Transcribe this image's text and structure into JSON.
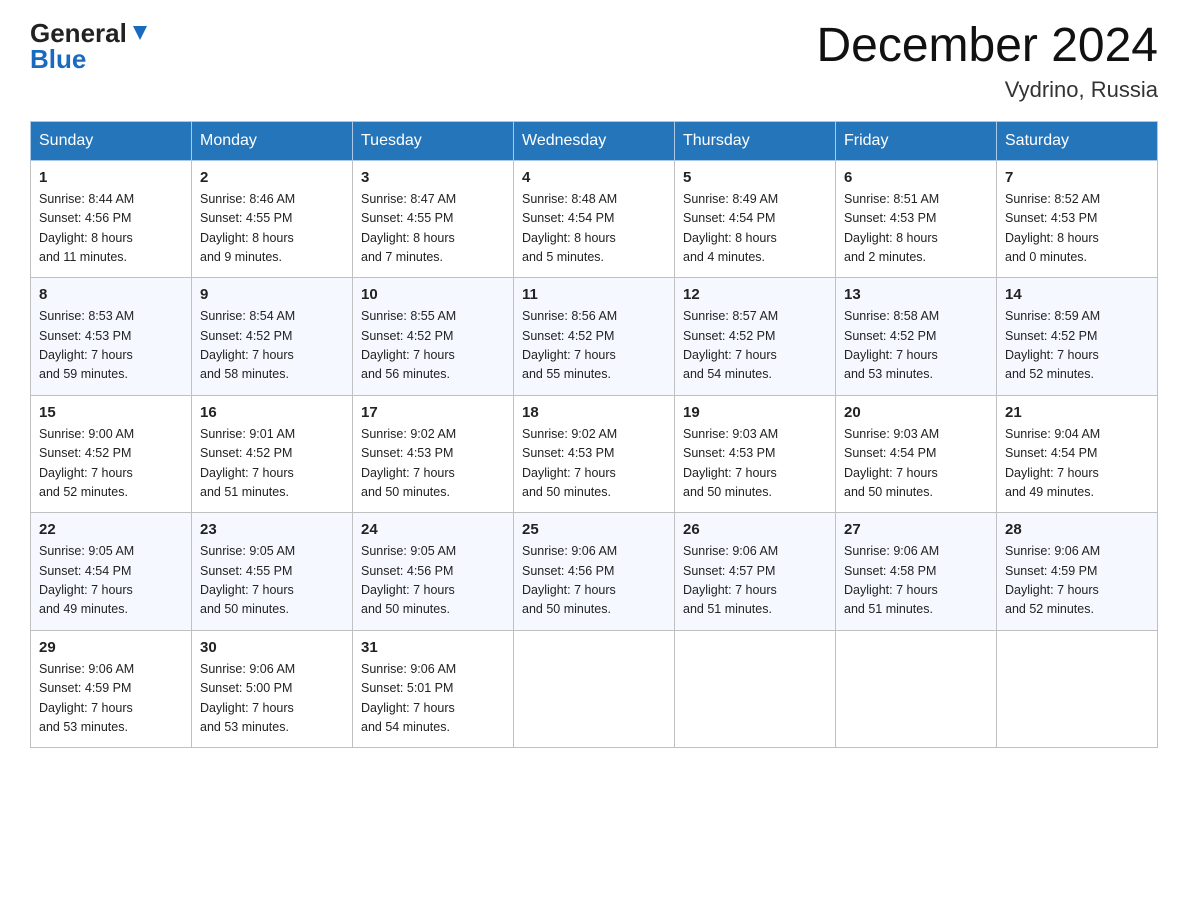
{
  "header": {
    "title": "December 2024",
    "location": "Vydrino, Russia",
    "logo_general": "General",
    "logo_blue": "Blue"
  },
  "days_of_week": [
    "Sunday",
    "Monday",
    "Tuesday",
    "Wednesday",
    "Thursday",
    "Friday",
    "Saturday"
  ],
  "weeks": [
    [
      {
        "day": "1",
        "sunrise": "8:44 AM",
        "sunset": "4:56 PM",
        "daylight": "8 hours and 11 minutes."
      },
      {
        "day": "2",
        "sunrise": "8:46 AM",
        "sunset": "4:55 PM",
        "daylight": "8 hours and 9 minutes."
      },
      {
        "day": "3",
        "sunrise": "8:47 AM",
        "sunset": "4:55 PM",
        "daylight": "8 hours and 7 minutes."
      },
      {
        "day": "4",
        "sunrise": "8:48 AM",
        "sunset": "4:54 PM",
        "daylight": "8 hours and 5 minutes."
      },
      {
        "day": "5",
        "sunrise": "8:49 AM",
        "sunset": "4:54 PM",
        "daylight": "8 hours and 4 minutes."
      },
      {
        "day": "6",
        "sunrise": "8:51 AM",
        "sunset": "4:53 PM",
        "daylight": "8 hours and 2 minutes."
      },
      {
        "day": "7",
        "sunrise": "8:52 AM",
        "sunset": "4:53 PM",
        "daylight": "8 hours and 0 minutes."
      }
    ],
    [
      {
        "day": "8",
        "sunrise": "8:53 AM",
        "sunset": "4:53 PM",
        "daylight": "7 hours and 59 minutes."
      },
      {
        "day": "9",
        "sunrise": "8:54 AM",
        "sunset": "4:52 PM",
        "daylight": "7 hours and 58 minutes."
      },
      {
        "day": "10",
        "sunrise": "8:55 AM",
        "sunset": "4:52 PM",
        "daylight": "7 hours and 56 minutes."
      },
      {
        "day": "11",
        "sunrise": "8:56 AM",
        "sunset": "4:52 PM",
        "daylight": "7 hours and 55 minutes."
      },
      {
        "day": "12",
        "sunrise": "8:57 AM",
        "sunset": "4:52 PM",
        "daylight": "7 hours and 54 minutes."
      },
      {
        "day": "13",
        "sunrise": "8:58 AM",
        "sunset": "4:52 PM",
        "daylight": "7 hours and 53 minutes."
      },
      {
        "day": "14",
        "sunrise": "8:59 AM",
        "sunset": "4:52 PM",
        "daylight": "7 hours and 52 minutes."
      }
    ],
    [
      {
        "day": "15",
        "sunrise": "9:00 AM",
        "sunset": "4:52 PM",
        "daylight": "7 hours and 52 minutes."
      },
      {
        "day": "16",
        "sunrise": "9:01 AM",
        "sunset": "4:52 PM",
        "daylight": "7 hours and 51 minutes."
      },
      {
        "day": "17",
        "sunrise": "9:02 AM",
        "sunset": "4:53 PM",
        "daylight": "7 hours and 50 minutes."
      },
      {
        "day": "18",
        "sunrise": "9:02 AM",
        "sunset": "4:53 PM",
        "daylight": "7 hours and 50 minutes."
      },
      {
        "day": "19",
        "sunrise": "9:03 AM",
        "sunset": "4:53 PM",
        "daylight": "7 hours and 50 minutes."
      },
      {
        "day": "20",
        "sunrise": "9:03 AM",
        "sunset": "4:54 PM",
        "daylight": "7 hours and 50 minutes."
      },
      {
        "day": "21",
        "sunrise": "9:04 AM",
        "sunset": "4:54 PM",
        "daylight": "7 hours and 49 minutes."
      }
    ],
    [
      {
        "day": "22",
        "sunrise": "9:05 AM",
        "sunset": "4:54 PM",
        "daylight": "7 hours and 49 minutes."
      },
      {
        "day": "23",
        "sunrise": "9:05 AM",
        "sunset": "4:55 PM",
        "daylight": "7 hours and 50 minutes."
      },
      {
        "day": "24",
        "sunrise": "9:05 AM",
        "sunset": "4:56 PM",
        "daylight": "7 hours and 50 minutes."
      },
      {
        "day": "25",
        "sunrise": "9:06 AM",
        "sunset": "4:56 PM",
        "daylight": "7 hours and 50 minutes."
      },
      {
        "day": "26",
        "sunrise": "9:06 AM",
        "sunset": "4:57 PM",
        "daylight": "7 hours and 51 minutes."
      },
      {
        "day": "27",
        "sunrise": "9:06 AM",
        "sunset": "4:58 PM",
        "daylight": "7 hours and 51 minutes."
      },
      {
        "day": "28",
        "sunrise": "9:06 AM",
        "sunset": "4:59 PM",
        "daylight": "7 hours and 52 minutes."
      }
    ],
    [
      {
        "day": "29",
        "sunrise": "9:06 AM",
        "sunset": "4:59 PM",
        "daylight": "7 hours and 53 minutes."
      },
      {
        "day": "30",
        "sunrise": "9:06 AM",
        "sunset": "5:00 PM",
        "daylight": "7 hours and 53 minutes."
      },
      {
        "day": "31",
        "sunrise": "9:06 AM",
        "sunset": "5:01 PM",
        "daylight": "7 hours and 54 minutes."
      },
      null,
      null,
      null,
      null
    ]
  ],
  "labels": {
    "sunrise": "Sunrise:",
    "sunset": "Sunset:",
    "daylight": "Daylight:"
  }
}
